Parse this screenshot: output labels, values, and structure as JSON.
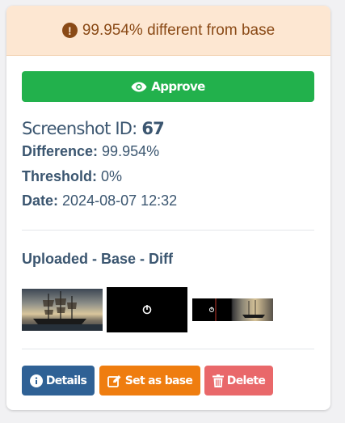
{
  "alert": {
    "icon": "exclamation-circle-icon",
    "text": "99.954% different from base"
  },
  "approve_button": {
    "label": "Approve",
    "icon": "eye-icon"
  },
  "screenshot": {
    "id_label": "Screenshot ID:",
    "id": "67"
  },
  "details": {
    "difference_label": "Difference:",
    "difference_value": "99.954%",
    "threshold_label": "Threshold:",
    "threshold_value": "0%",
    "date_label": "Date:",
    "date_value": "2024-08-07 12:32"
  },
  "images_section": {
    "title": "Uploaded - Base - Diff"
  },
  "actions": {
    "details": {
      "label": "Details",
      "icon": "info-circle-icon"
    },
    "set_base": {
      "label": "Set as base",
      "icon": "edit-icon"
    },
    "delete": {
      "label": "Delete",
      "icon": "trash-icon"
    }
  },
  "colors": {
    "alert_bg": "#fde7d2",
    "alert_text": "#8a4a16",
    "approve": "#22b14c",
    "details": "#2f6195",
    "set_base": "#ef7d0f",
    "delete": "#e9686a",
    "text": "#3b5670"
  }
}
